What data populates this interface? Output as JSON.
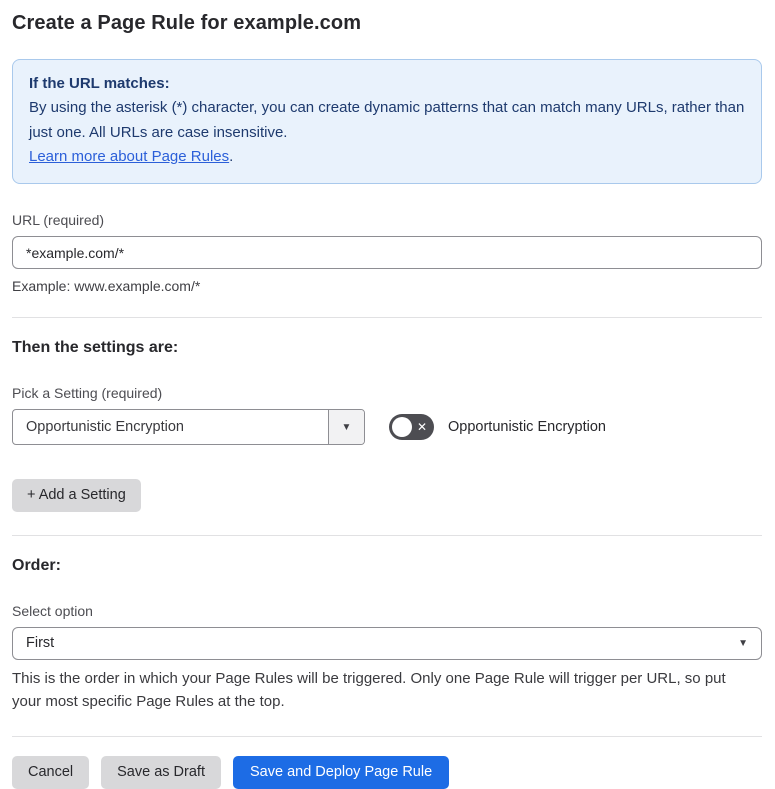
{
  "page": {
    "title": "Create a Page Rule for example.com"
  },
  "info_box": {
    "heading": "If the URL matches:",
    "body": "By using the asterisk (*) character, you can create dynamic patterns that can match many URLs, rather than just one. All URLs are case insensitive.",
    "link_label": "Learn more about Page Rules",
    "link_suffix": "."
  },
  "url_section": {
    "label": "URL (required)",
    "value": "*example.com/*",
    "helper": "Example: www.example.com/*"
  },
  "settings_section": {
    "heading": "Then the settings are:",
    "picker_label": "Pick a Setting (required)",
    "selected_setting": "Opportunistic Encryption",
    "toggle_label": "Opportunistic Encryption",
    "toggle_state": "off",
    "add_setting_button": "+ Add a Setting"
  },
  "order_section": {
    "heading": "Order:",
    "select_label": "Select option",
    "selected_option": "First",
    "helper": "This is the order in which your Page Rules will be triggered. Only one Page Rule will trigger per URL, so put your most specific Page Rules at the top."
  },
  "footer": {
    "cancel_label": "Cancel",
    "save_draft_label": "Save as Draft",
    "save_deploy_label": "Save and Deploy Page Rule"
  },
  "icons": {
    "dropdown_arrow": "▼",
    "toggle_off_x": "✕"
  },
  "colors": {
    "primary_blue": "#1d6ce5",
    "info_box_bg": "#e9f2fc",
    "info_box_border": "#a9c9ec",
    "info_box_text": "#1e3a6e",
    "link_blue": "#2b5fd9",
    "gray_button_bg": "#d8d8da",
    "toggle_off_bg": "#4d4d52"
  }
}
